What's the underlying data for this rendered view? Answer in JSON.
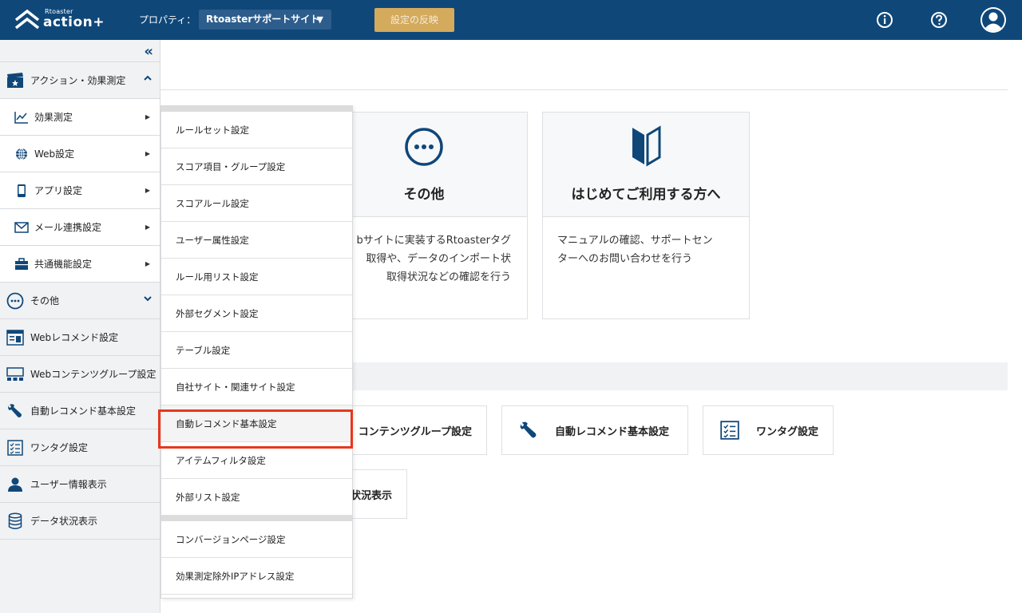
{
  "header": {
    "logo_small": "Rtoaster",
    "logo_main": "action+",
    "property_label": "プロパティ：",
    "property_value": "Rtoasterサポートサイト",
    "property_arrow": "▼",
    "apply_label": "設定の反映"
  },
  "sidebar": {
    "collapse": "«",
    "items": [
      {
        "label": "アクション・効果測定"
      },
      {
        "label": "効果測定"
      },
      {
        "label": "Web設定"
      },
      {
        "label": "アプリ設定"
      },
      {
        "label": "メール連携設定"
      },
      {
        "label": "共通機能設定"
      },
      {
        "label": "その他"
      },
      {
        "label": "Webレコメンド設定"
      },
      {
        "label": "Webコンテンツグループ設定"
      },
      {
        "label": "自動レコメンド基本設定"
      },
      {
        "label": "ワンタグ設定"
      },
      {
        "label": "ユーザー情報表示"
      },
      {
        "label": "データ状況表示"
      }
    ],
    "sub_arrow": "▶"
  },
  "cards": [
    {
      "title": "その他",
      "body1": "bサイトに実装するRtoasterタグ",
      "body2": "取得や、データのインポート状",
      "body3": "取得状況などの確認を行う"
    },
    {
      "title": "はじめてご利用する方へ",
      "body1": "マニュアルの確認、サポートセン",
      "body2": "ターへのお問い合わせを行う",
      "body3": ""
    }
  ],
  "tiles": [
    {
      "label": "コンテンツグループ設定"
    },
    {
      "label": "自動レコメンド基本設定"
    },
    {
      "label": "ワンタグ設定"
    },
    {
      "label": "状況表示"
    }
  ],
  "flyout": {
    "items": [
      "ルールセット設定",
      "スコア項目・グループ設定",
      "スコアルール設定",
      "ユーザー属性設定",
      "ルール用リスト設定",
      "外部セグメント設定",
      "テーブル設定",
      "自社サイト・関連サイト設定",
      "自動レコメンド基本設定",
      "アイテムフィルタ設定",
      "外部リスト設定",
      "コンバージョンページ設定",
      "効果測定除外IPアドレス設定"
    ]
  },
  "colors": {
    "header_bg": "#0f4779",
    "apply_btn": "#d4aa5c",
    "highlight": "#e8371d"
  }
}
